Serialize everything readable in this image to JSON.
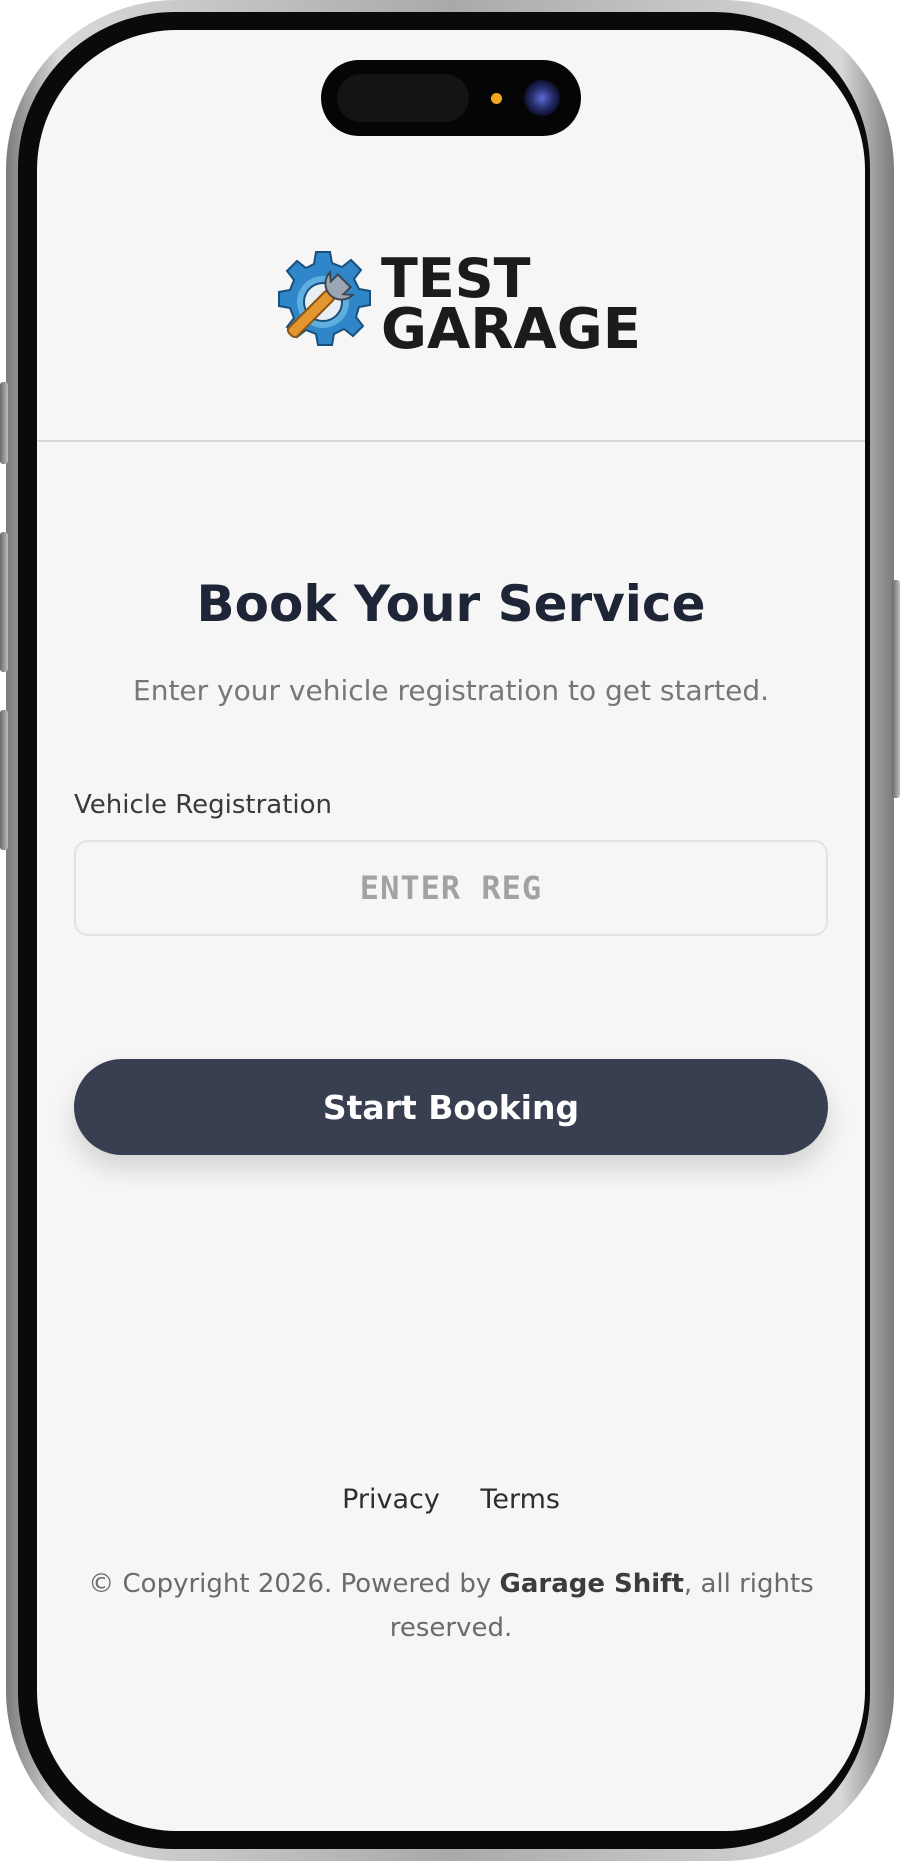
{
  "brand": {
    "logo_line1": "TEST",
    "logo_line2": "GARAGE",
    "gear_color": "#2f86c8",
    "wrench_color": "#e3962f"
  },
  "main": {
    "title": "Book Your Service",
    "subtitle": "Enter your vehicle registration to get started.",
    "field_label": "Vehicle Registration",
    "reg_placeholder": "ENTER REG",
    "reg_value": "",
    "submit_label": "Start Booking",
    "button_color": "#373f50"
  },
  "footer": {
    "privacy_label": "Privacy",
    "terms_label": "Terms",
    "copyright_prefix": "© Copyright 2026. Powered by ",
    "copyright_brand": "Garage Shift",
    "copyright_suffix": ", all rights reserved."
  }
}
